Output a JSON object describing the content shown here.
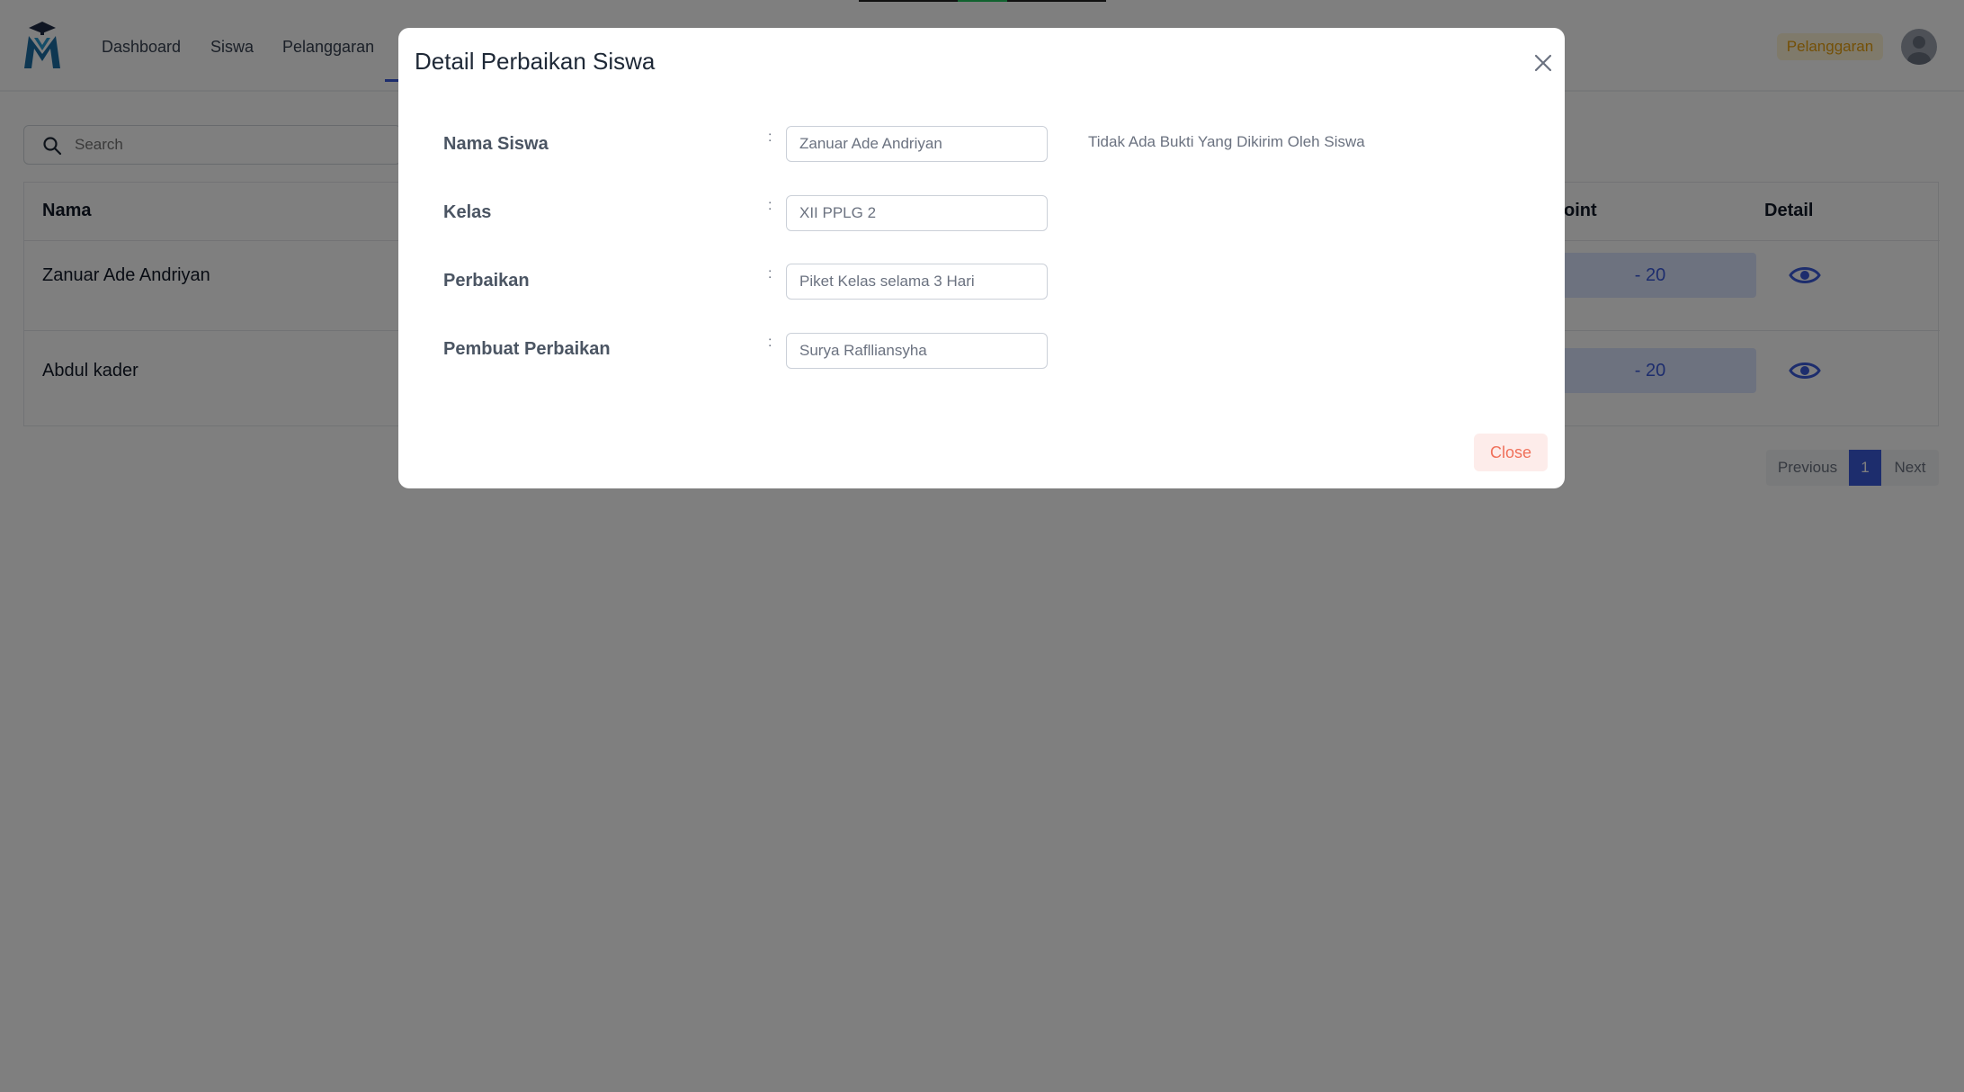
{
  "nav": {
    "items": [
      {
        "label": "Dashboard"
      },
      {
        "label": "Siswa"
      },
      {
        "label": "Pelanggaran"
      }
    ],
    "role_badge": "Pelanggaran"
  },
  "search": {
    "placeholder": "Search"
  },
  "table": {
    "headers": {
      "name": "Nama",
      "point": "oint",
      "detail": "Detail"
    },
    "rows": [
      {
        "name": "Zanuar Ade Andriyan",
        "point": "- 20"
      },
      {
        "name": "Abdul kader",
        "point": "- 20"
      }
    ]
  },
  "pagination": {
    "previous": "Previous",
    "current": "1",
    "next": "Next"
  },
  "modal": {
    "title": "Detail Perbaikan Siswa",
    "colon": ":",
    "fields": [
      {
        "label": "Nama Siswa",
        "value": "Zanuar Ade Andriyan"
      },
      {
        "label": "Kelas",
        "value": "XII PPLG 2"
      },
      {
        "label": "Perbaikan",
        "value": "Piket Kelas selama 3 Hari"
      },
      {
        "label": "Pembuat Perbaikan",
        "value": "Surya Raflliansyha"
      }
    ],
    "no_proof_text": "Tidak Ada Bukti Yang Dikirim Oleh Siswa",
    "close_label": "Close"
  },
  "colors": {
    "primary": "#3b5bdb",
    "badge_text": "#e8a10e",
    "badge_bg": "#fff4d6",
    "close_text": "#f0705a",
    "close_bg": "#fdecea",
    "overlay": "rgba(0,0,0,0.5)"
  }
}
